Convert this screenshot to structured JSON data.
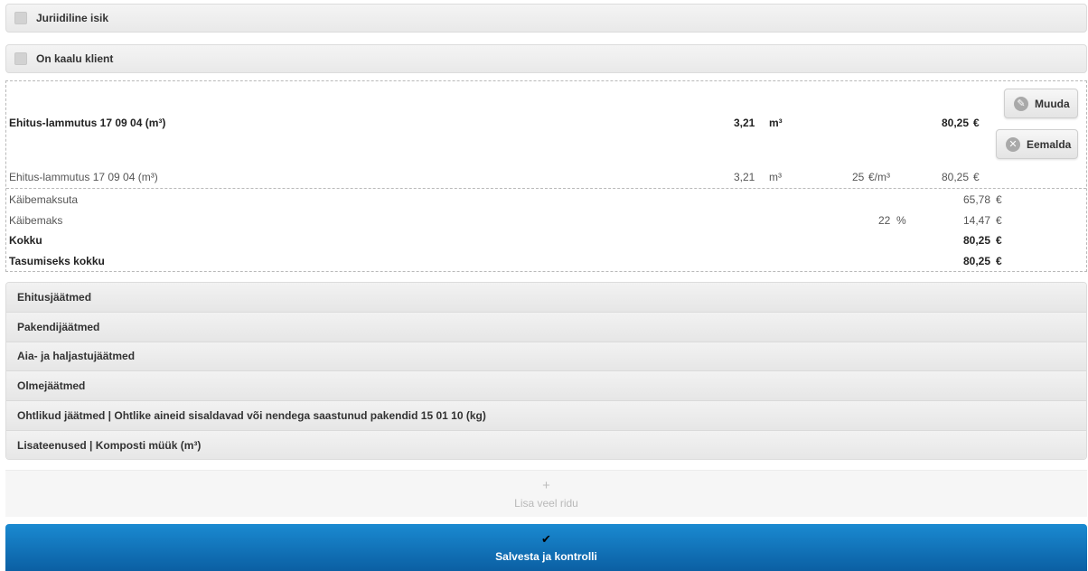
{
  "checkboxes": [
    {
      "label": "Juriidiline isik",
      "checked": false
    },
    {
      "label": "On kaalu klient",
      "checked": false
    }
  ],
  "item": {
    "title": "Ehitus-lammutus 17 09 04 (m³)",
    "quantity": "3,21",
    "unit": "m³",
    "total": "80,25",
    "currency": "€",
    "detail": {
      "name": "Ehitus-lammutus 17 09 04 (m³)",
      "quantity": "3,21",
      "unit": "m³",
      "price": "25",
      "price_unit": "€/m³",
      "total": "80,25",
      "currency": "€"
    },
    "edit_label": "Muuda",
    "remove_label": "Eemalda"
  },
  "summary": {
    "net_label": "Käibemaksuta",
    "net_value": "65,78",
    "vat_label": "Käibemaks",
    "vat_rate": "22",
    "vat_rate_unit": "%",
    "vat_value": "14,47",
    "total_label": "Kokku",
    "total_value": "80,25",
    "payable_label": "Tasumiseks kokku",
    "payable_value": "80,25",
    "currency": "€"
  },
  "categories": [
    "Ehitusjäätmed",
    "Pakendijäätmed",
    "Aia- ja haljastujäätmed",
    "Olmejäätmed",
    "Ohtlikud jäätmed | Ohtlike aineid sisaldavad või nendega saastunud pakendid 15 01 10 (kg)",
    "Lisateenused | Komposti müük (m³)"
  ],
  "add_row": {
    "icon": "plus-icon",
    "label": "Lisa veel ridu"
  },
  "save": {
    "icon": "checkmark-icon",
    "label": "Salvesta ja kontrolli"
  },
  "colors": {
    "save_button": "#0b6fb8",
    "category_bg": "#ececec"
  }
}
